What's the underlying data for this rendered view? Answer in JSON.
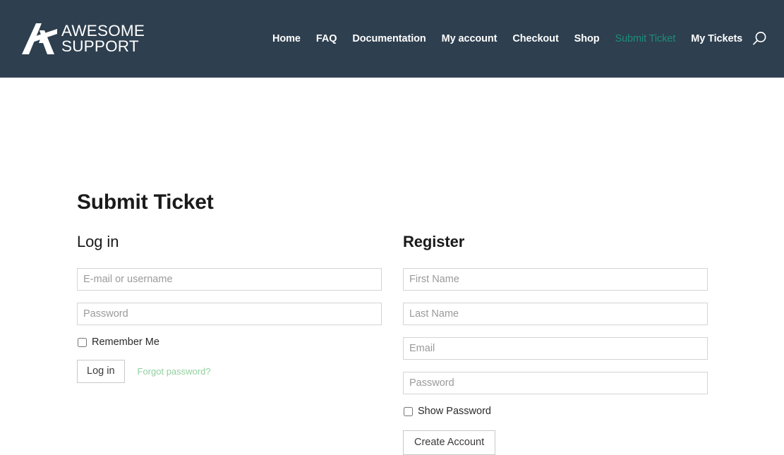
{
  "header": {
    "background_color": "#2e3f4f",
    "brand": {
      "logo_icon": "awesome-support-logo-icon",
      "line1": "AWESOME",
      "line2": "SUPPORT"
    },
    "nav": [
      {
        "label": "Home",
        "current": false
      },
      {
        "label": "FAQ",
        "current": false
      },
      {
        "label": "Documentation",
        "current": false
      },
      {
        "label": "My account",
        "current": false
      },
      {
        "label": "Checkout",
        "current": false
      },
      {
        "label": "Shop",
        "current": false
      },
      {
        "label": "Submit Ticket",
        "current": true
      },
      {
        "label": "My Tickets",
        "current": false
      }
    ],
    "current_nav_color": "#1f8c78",
    "search_icon": "search-icon"
  },
  "page": {
    "title": "Submit Ticket"
  },
  "login": {
    "heading": "Log in",
    "username_placeholder": "E-mail or username",
    "username_value": "",
    "password_placeholder": "Password",
    "password_value": "",
    "remember_label": "Remember Me",
    "remember_checked": false,
    "submit_label": "Log in",
    "forgot_label": "Forgot password?",
    "forgot_link_color": "#91cf9e"
  },
  "register": {
    "heading": "Register",
    "first_name_placeholder": "First Name",
    "first_name_value": "",
    "last_name_placeholder": "Last Name",
    "last_name_value": "",
    "email_placeholder": "Email",
    "email_value": "",
    "password_placeholder": "Password",
    "password_value": "",
    "show_password_label": "Show Password",
    "show_password_checked": false,
    "submit_label": "Create Account"
  }
}
